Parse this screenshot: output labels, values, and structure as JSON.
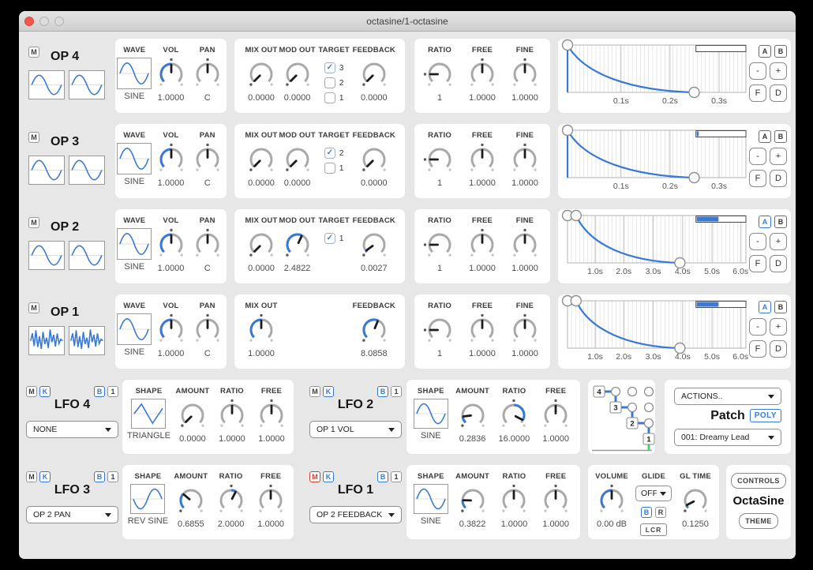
{
  "window_title": "octasine/1-octasine",
  "accent": "#3879d6",
  "env_buttons": {
    "a": "A",
    "b": "B",
    "minus": "-",
    "plus": "+",
    "fit": "F",
    "d": "D"
  },
  "operators": [
    {
      "name": "OP 4",
      "mute": "M",
      "thumb": "sine",
      "wave": {
        "label": "WAVE",
        "value": "SINE",
        "shape": "sine"
      },
      "knobs1": [
        {
          "label": "VOL",
          "value": "1.0000",
          "ptr": 0,
          "arc": [
            -135,
            0
          ],
          "def": 0
        },
        {
          "label": "PAN",
          "value": "C",
          "ptr": 0,
          "arc": null,
          "def": 0
        }
      ],
      "mods": [
        {
          "type": "knob",
          "label": "MIX OUT",
          "value": "0.0000",
          "ptr": -135,
          "arc": null,
          "def": -135
        },
        {
          "type": "knob",
          "label": "MOD OUT",
          "value": "0.0000",
          "ptr": -135,
          "arc": null,
          "def": -135
        },
        {
          "type": "targets",
          "label": "TARGET",
          "options": [
            {
              "label": "3",
              "checked": true
            },
            {
              "label": "2",
              "checked": false
            },
            {
              "label": "1",
              "checked": false
            }
          ]
        },
        {
          "type": "knob",
          "label": "FEEDBACK",
          "value": "0.0000",
          "ptr": -135,
          "arc": null,
          "def": -135
        }
      ],
      "freq": [
        {
          "label": "RATIO",
          "value": "1",
          "ptr": -90,
          "arc": null,
          "def": -90
        },
        {
          "label": "FREE",
          "value": "1.0000",
          "ptr": 0,
          "arc": null,
          "def": 0
        },
        {
          "label": "FINE",
          "value": "1.0000",
          "ptr": 0,
          "arc": null,
          "def": 0
        }
      ],
      "env": {
        "labels": [
          {
            "text": "0.1s",
            "x": 0.3
          },
          {
            "text": "0.2s",
            "x": 0.575
          },
          {
            "text": "0.3s",
            "x": 0.85
          }
        ],
        "attack_x": 0,
        "attack_style": "vertical",
        "end_x": 0.71,
        "bar_start": 0.72,
        "bar_fill": 0,
        "group_a_active": false
      }
    },
    {
      "name": "OP 3",
      "mute": "M",
      "thumb": "sine",
      "wave": {
        "label": "WAVE",
        "value": "SINE",
        "shape": "sine"
      },
      "knobs1": [
        {
          "label": "VOL",
          "value": "1.0000",
          "ptr": 0,
          "arc": [
            -135,
            0
          ],
          "def": 0
        },
        {
          "label": "PAN",
          "value": "C",
          "ptr": 0,
          "arc": null,
          "def": 0
        }
      ],
      "mods": [
        {
          "type": "knob",
          "label": "MIX OUT",
          "value": "0.0000",
          "ptr": -135,
          "arc": null,
          "def": -135
        },
        {
          "type": "knob",
          "label": "MOD OUT",
          "value": "0.0000",
          "ptr": -135,
          "arc": null,
          "def": -135
        },
        {
          "type": "targets",
          "label": "TARGET",
          "options": [
            {
              "label": "2",
              "checked": true
            },
            {
              "label": "1",
              "checked": false
            }
          ]
        },
        {
          "type": "knob",
          "label": "FEEDBACK",
          "value": "0.0000",
          "ptr": -135,
          "arc": null,
          "def": -135
        }
      ],
      "freq": [
        {
          "label": "RATIO",
          "value": "1",
          "ptr": -90,
          "arc": null,
          "def": -90
        },
        {
          "label": "FREE",
          "value": "1.0000",
          "ptr": 0,
          "arc": null,
          "def": 0
        },
        {
          "label": "FINE",
          "value": "1.0000",
          "ptr": 0,
          "arc": null,
          "def": 0
        }
      ],
      "env": {
        "labels": [
          {
            "text": "0.1s",
            "x": 0.3
          },
          {
            "text": "0.2s",
            "x": 0.575
          },
          {
            "text": "0.3s",
            "x": 0.85
          }
        ],
        "attack_x": 0,
        "attack_style": "vertical",
        "end_x": 0.71,
        "bar_start": 0.72,
        "bar_fill": 0.04,
        "group_a_active": false
      }
    },
    {
      "name": "OP 2",
      "mute": "M",
      "thumb": "sine",
      "wave": {
        "label": "WAVE",
        "value": "SINE",
        "shape": "sine"
      },
      "knobs1": [
        {
          "label": "VOL",
          "value": "1.0000",
          "ptr": 0,
          "arc": [
            -135,
            0
          ],
          "def": 0
        },
        {
          "label": "PAN",
          "value": "C",
          "ptr": 0,
          "arc": null,
          "def": 0
        }
      ],
      "mods": [
        {
          "type": "knob",
          "label": "MIX OUT",
          "value": "0.0000",
          "ptr": -135,
          "arc": null,
          "def": -135
        },
        {
          "type": "knob",
          "label": "MOD OUT",
          "value": "2.4822",
          "ptr": 25,
          "arc": [
            -135,
            25
          ],
          "def": -135
        },
        {
          "type": "targets",
          "label": "TARGET",
          "options": [
            {
              "label": "1",
              "checked": true
            }
          ]
        },
        {
          "type": "knob",
          "label": "FEEDBACK",
          "value": "0.0027",
          "ptr": -126,
          "arc": [
            -135,
            -126
          ],
          "def": -135
        }
      ],
      "freq": [
        {
          "label": "RATIO",
          "value": "1",
          "ptr": -90,
          "arc": null,
          "def": -90
        },
        {
          "label": "FREE",
          "value": "1.0000",
          "ptr": 0,
          "arc": null,
          "def": 0
        },
        {
          "label": "FINE",
          "value": "1.0000",
          "ptr": 0,
          "arc": null,
          "def": 0
        }
      ],
      "env": {
        "labels": [
          {
            "text": "1.0s",
            "x": 0.155
          },
          {
            "text": "2.0s",
            "x": 0.315
          },
          {
            "text": "3.0s",
            "x": 0.48
          },
          {
            "text": "4.0s",
            "x": 0.645
          },
          {
            "text": "5.0s",
            "x": 0.81
          },
          {
            "text": "6.0s",
            "x": 0.97
          }
        ],
        "attack_x": 0.048,
        "attack_style": "flat",
        "end_x": 0.63,
        "bar_start": 0.72,
        "bar_fill": 0.45,
        "group_a_active": true
      }
    },
    {
      "name": "OP 1",
      "mute": "M",
      "thumb": "noise",
      "wave": {
        "label": "WAVE",
        "value": "SINE",
        "shape": "sine"
      },
      "knobs1": [
        {
          "label": "VOL",
          "value": "1.0000",
          "ptr": 0,
          "arc": [
            -135,
            0
          ],
          "def": 0
        },
        {
          "label": "PAN",
          "value": "C",
          "ptr": 0,
          "arc": null,
          "def": 0
        }
      ],
      "mods": [
        {
          "type": "knob",
          "label": "MIX OUT",
          "value": "1.0000",
          "ptr": 0,
          "arc": [
            -135,
            0
          ],
          "def": 0
        },
        {
          "type": "empty"
        },
        {
          "type": "empty"
        },
        {
          "type": "knob",
          "label": "FEEDBACK",
          "value": "8.0858",
          "ptr": 22,
          "arc": [
            -135,
            22
          ],
          "def": -135
        }
      ],
      "freq": [
        {
          "label": "RATIO",
          "value": "1",
          "ptr": -90,
          "arc": null,
          "def": -90
        },
        {
          "label": "FREE",
          "value": "1.0000",
          "ptr": 0,
          "arc": null,
          "def": 0
        },
        {
          "label": "FINE",
          "value": "1.0000",
          "ptr": 0,
          "arc": null,
          "def": 0
        }
      ],
      "env": {
        "labels": [
          {
            "text": "1.0s",
            "x": 0.155
          },
          {
            "text": "2.0s",
            "x": 0.315
          },
          {
            "text": "3.0s",
            "x": 0.48
          },
          {
            "text": "4.0s",
            "x": 0.645
          },
          {
            "text": "5.0s",
            "x": 0.81
          },
          {
            "text": "6.0s",
            "x": 0.97
          }
        ],
        "attack_x": 0.048,
        "attack_style": "flat",
        "end_x": 0.63,
        "bar_start": 0.72,
        "bar_fill": 0.45,
        "group_a_active": true
      }
    }
  ],
  "lfos": [
    {
      "name": "LFO 4",
      "buttons": [
        {
          "label": "M",
          "style": "gray"
        },
        {
          "label": "K",
          "style": "blue"
        },
        {
          "label": "B",
          "style": "blue"
        },
        {
          "label": "1",
          "style": "gray"
        }
      ],
      "target": "NONE",
      "shape": {
        "label": "SHAPE",
        "value": "TRIANGLE",
        "icon": "triangle"
      },
      "knobs": [
        {
          "label": "AMOUNT",
          "value": "0.0000",
          "ptr": -135,
          "arc": null,
          "def": -135
        },
        {
          "label": "RATIO",
          "value": "1.0000",
          "ptr": 0,
          "arc": null,
          "def": 0
        },
        {
          "label": "FREE",
          "value": "1.0000",
          "ptr": 0,
          "arc": null,
          "def": 0
        }
      ]
    },
    {
      "name": "LFO 2",
      "buttons": [
        {
          "label": "M",
          "style": "gray"
        },
        {
          "label": "K",
          "style": "blue"
        },
        {
          "label": "B",
          "style": "blue"
        },
        {
          "label": "1",
          "style": "gray"
        }
      ],
      "target": "OP 1 VOL",
      "shape": {
        "label": "SHAPE",
        "value": "SINE",
        "icon": "sine"
      },
      "knobs": [
        {
          "label": "AMOUNT",
          "value": "0.2836",
          "ptr": -97,
          "arc": [
            -135,
            -97
          ],
          "def": -135
        },
        {
          "label": "RATIO",
          "value": "16.0000",
          "ptr": 118,
          "arc": [
            0,
            118
          ],
          "def": 0
        },
        {
          "label": "FREE",
          "value": "1.0000",
          "ptr": 0,
          "arc": null,
          "def": 0
        }
      ]
    },
    {
      "name": "LFO 3",
      "buttons": [
        {
          "label": "M",
          "style": "gray"
        },
        {
          "label": "K",
          "style": "blue"
        },
        {
          "label": "B",
          "style": "blue"
        },
        {
          "label": "1",
          "style": "gray"
        }
      ],
      "target": "OP 2 PAN",
      "shape": {
        "label": "SHAPE",
        "value": "REV SINE",
        "icon": "revsine"
      },
      "knobs": [
        {
          "label": "AMOUNT",
          "value": "0.6855",
          "ptr": -50,
          "arc": [
            -135,
            -50
          ],
          "def": -135
        },
        {
          "label": "RATIO",
          "value": "2.0000",
          "ptr": 27,
          "arc": [
            0,
            27
          ],
          "def": 0
        },
        {
          "label": "FREE",
          "value": "1.0000",
          "ptr": 0,
          "arc": null,
          "def": 0
        }
      ]
    },
    {
      "name": "LFO 1",
      "buttons": [
        {
          "label": "M",
          "style": "red"
        },
        {
          "label": "K",
          "style": "blue"
        },
        {
          "label": "B",
          "style": "blue"
        },
        {
          "label": "1",
          "style": "gray"
        }
      ],
      "target": "OP 2 FEEDBACK",
      "shape": {
        "label": "SHAPE",
        "value": "SINE",
        "icon": "sine"
      },
      "knobs": [
        {
          "label": "AMOUNT",
          "value": "0.3822",
          "ptr": -88,
          "arc": [
            -135,
            -88
          ],
          "def": -135
        },
        {
          "label": "RATIO",
          "value": "1.0000",
          "ptr": 0,
          "arc": null,
          "def": 0
        },
        {
          "label": "FREE",
          "value": "1.0000",
          "ptr": 0,
          "arc": null,
          "def": 0
        }
      ]
    }
  ],
  "routing": {
    "boxes": [
      "4",
      "3",
      "2",
      "1"
    ]
  },
  "patch": {
    "actions": "ACTIONS..",
    "title": "Patch",
    "poly": "POLY",
    "preset": "001: Dreamy Lead"
  },
  "master": {
    "volume": {
      "label": "VOLUME",
      "value": "0.00 dB",
      "ptr": 0,
      "arc": [
        -135,
        0
      ],
      "def": 0
    },
    "glide": {
      "label": "GLIDE",
      "mode": "OFF",
      "b": "B",
      "r": "R",
      "lcr": "LCR"
    },
    "gl_time": {
      "label": "GL TIME",
      "value": "0.1250",
      "ptr": -118,
      "arc": [
        -135,
        -118
      ],
      "def": -135
    }
  },
  "branding": {
    "controls": "CONTROLS",
    "name": "OctaSine",
    "theme": "THEME"
  }
}
